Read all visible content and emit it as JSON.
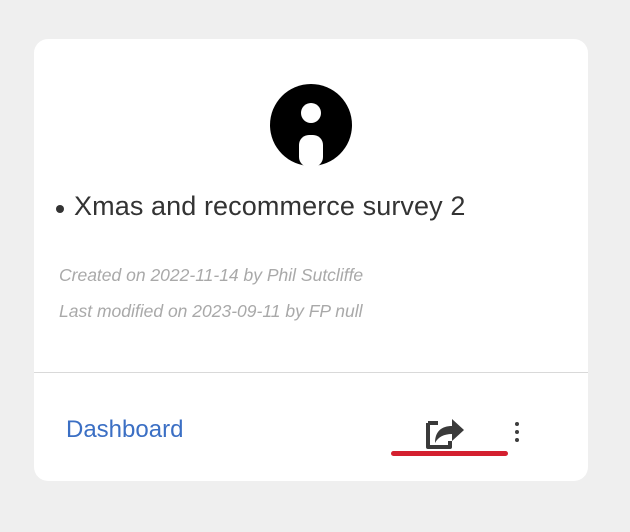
{
  "card": {
    "avatar_icon": "user-avatar-icon",
    "title": "Xmas and recommerce survey 2",
    "created": "Created on 2022-11-14 by Phil Sutcliffe",
    "modified": "Last modified on 2023-09-11 by FP null",
    "dashboard_label": "Dashboard",
    "share_icon": "share-icon",
    "more_icon": "kebab-menu-icon"
  },
  "colors": {
    "background": "#efefef",
    "card": "#ffffff",
    "link": "#3b6fc4",
    "highlight": "#d4202f",
    "meta_text": "#a9a9a9"
  }
}
